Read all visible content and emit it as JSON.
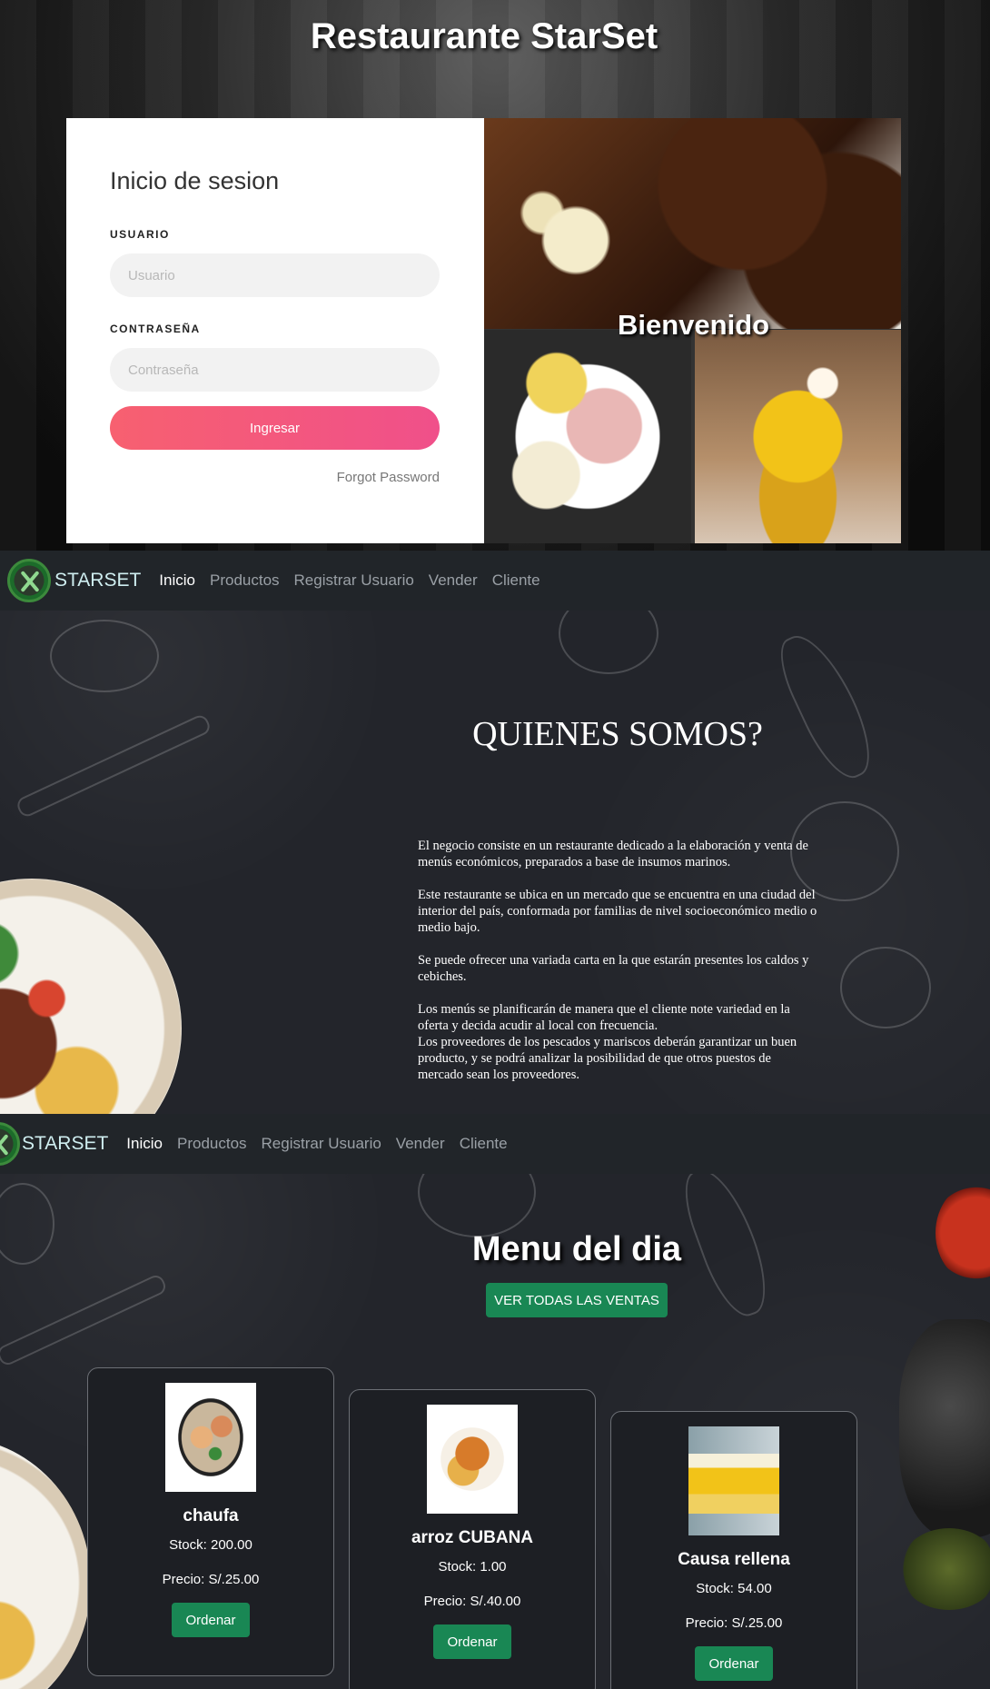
{
  "login": {
    "site_title": "Restaurante StarSet",
    "heading": "Inicio de sesion",
    "username_label": "USUARIO",
    "username_placeholder": "Usuario",
    "password_label": "CONTRASEÑA",
    "password_placeholder": "Contraseña",
    "submit_label": "Ingresar",
    "forgot_label": "Forgot Password",
    "welcome": "Bienvenido"
  },
  "navbar": {
    "brand": "STARSET",
    "links": [
      "Inicio",
      "Productos",
      "Registrar Usuario",
      "Vender",
      "Cliente"
    ],
    "active": "Inicio"
  },
  "about": {
    "title": "QUIENES SOMOS?",
    "paragraphs": [
      "El negocio consiste en un restaurante dedicado a la elaboración y venta de menús económicos, preparados a base de insumos marinos.",
      "Este restaurante se ubica en un mercado que se encuentra en una ciudad del interior del país, conformada por familias de nivel socioeconómico medio o medio bajo.",
      "Se puede ofrecer una variada carta en la que estarán presentes los caldos y cebiches.",
      "Los menús se planificarán de manera que el cliente note variedad en la oferta y decida acudir al local con frecuencia.",
      "Los proveedores de los pescados y mariscos deberán garantizar un buen producto, y se podrá analizar la posibilidad de que otros puestos de mercado sean los proveedores."
    ]
  },
  "menu": {
    "title": "Menu del dia",
    "all_sales_label": "VER TODAS LAS VENTAS",
    "order_label": "Ordenar",
    "products": [
      {
        "name": "chaufa",
        "stock": "Stock: 200.00",
        "price": "Precio: S/.25.00"
      },
      {
        "name": "arroz CUBANA",
        "stock": "Stock: 1.00",
        "price": "Precio: S/.40.00"
      },
      {
        "name": "Causa rellena",
        "stock": "Stock: 54.00",
        "price": "Precio: S/.25.00"
      }
    ]
  },
  "colors": {
    "accent_pink": "#f76070",
    "success_green": "#198754",
    "navbar_bg": "#212529"
  },
  "icons": {
    "logo": "crossed-fork-knife-icon"
  }
}
